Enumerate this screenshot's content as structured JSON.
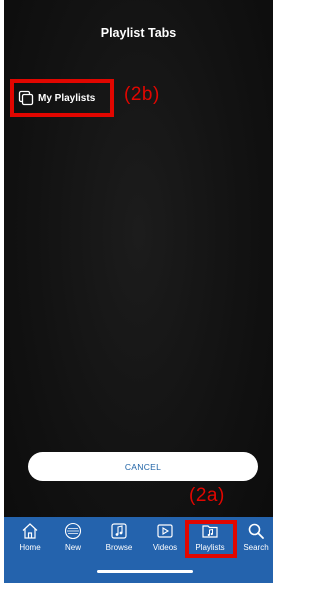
{
  "header": {
    "title": "Playlist Tabs"
  },
  "playlists": {
    "my_playlists_label": "My Playlists",
    "icon": "playlist-stack-icon"
  },
  "annotations": {
    "label_b": "(2b)",
    "label_a": "(2a)",
    "color": "#e10600"
  },
  "actions": {
    "cancel_label": "CANCEL"
  },
  "tabbar": {
    "background": "#2463ad",
    "items": [
      {
        "label": "Home",
        "icon": "home-icon"
      },
      {
        "label": "New",
        "icon": "new-icon"
      },
      {
        "label": "Browse",
        "icon": "music-note-icon"
      },
      {
        "label": "Videos",
        "icon": "play-icon"
      },
      {
        "label": "Playlists",
        "icon": "playlist-folder-icon",
        "selected": true
      },
      {
        "label": "Search",
        "icon": "search-icon"
      }
    ]
  }
}
